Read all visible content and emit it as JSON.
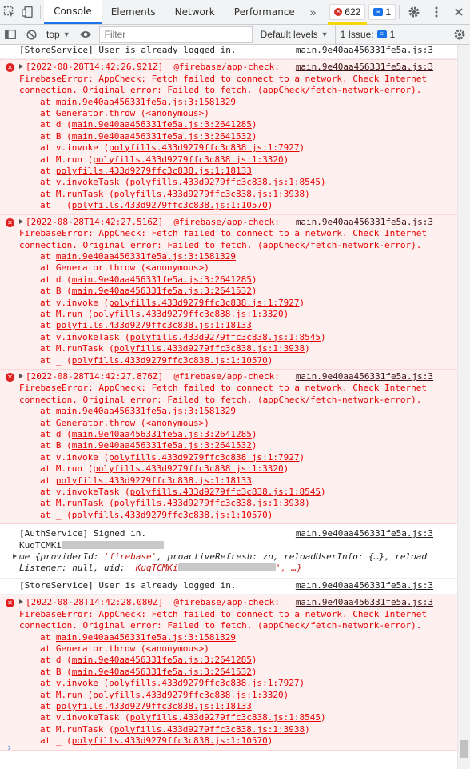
{
  "tabs": {
    "console": "Console",
    "elements": "Elements",
    "network": "Network",
    "performance": "Performance",
    "more": "»"
  },
  "badges": {
    "errors": "622",
    "messages": "1"
  },
  "toolbar": {
    "context": "top",
    "filter_placeholder": "Filter",
    "levels": "Default levels",
    "issues_label": "1 Issue:",
    "issues_count": "1"
  },
  "messages": {
    "store1": {
      "text": "[StoreService] User is already logged in.",
      "src": "main.9e40aa456331fe5a.js:3"
    },
    "err1": {
      "head": "[2022-08-28T14:42:26.921Z]  @firebase/app-check:",
      "src": "main.9e40aa456331fe5a.js:3",
      "line1": "FirebaseError: AppCheck: Fetch failed to connect to a network. Check Internet",
      "line2": "connection. Original error: Failed to fetch. (appCheck/fetch-network-error)."
    },
    "err2": {
      "head": "[2022-08-28T14:42:27.516Z]  @firebase/app-check:",
      "src": "main.9e40aa456331fe5a.js:3",
      "line1": "FirebaseError: AppCheck: Fetch failed to connect to a network. Check Internet",
      "line2": "connection. Original error: Failed to fetch. (appCheck/fetch-network-error)."
    },
    "err3": {
      "head": "[2022-08-28T14:42:27.876Z]  @firebase/app-check:",
      "src": "main.9e40aa456331fe5a.js:3",
      "line1": "FirebaseError: AppCheck: Fetch failed to connect to a network. Check Internet",
      "line2": "connection. Original error: Failed to fetch. (appCheck/fetch-network-error)."
    },
    "auth": {
      "line1": "[AuthService] Signed in.",
      "src": "main.9e40aa456331fe5a.js:3",
      "uid_prefix": "KuqTCMKi",
      "obj_line1_a": "me {providerId: ",
      "obj_line1_b": "'firebase'",
      "obj_line1_c": ", proactiveRefresh: zn, reloadUserInfo: {…}, reload",
      "obj_line2_a": "Listener: null, uid: ",
      "obj_line2_b": "'KuqTCMKi",
      "obj_line2_c": "', …}"
    },
    "store2": {
      "text": "[StoreService] User is already logged in.",
      "src": "main.9e40aa456331fe5a.js:3"
    },
    "err4": {
      "head": "[2022-08-28T14:42:28.080Z]  @firebase/app-check:",
      "src": "main.9e40aa456331fe5a.js:3",
      "line1": "FirebaseError: AppCheck: Fetch failed to connect to a network. Check Internet",
      "line2": "connection. Original error: Failed to fetch. (appCheck/fetch-network-error)."
    }
  },
  "stack": [
    {
      "fn": "at ",
      "loc": "main.9e40aa456331fe5a.js:3:1581329",
      "wrap": false
    },
    {
      "fn": "at Generator.throw (<anonymous>)",
      "loc": "",
      "wrap": false
    },
    {
      "fn": "at d (",
      "loc": "main.9e40aa456331fe5a.js:3:2641285",
      "wrap": true
    },
    {
      "fn": "at B (",
      "loc": "main.9e40aa456331fe5a.js:3:2641532",
      "wrap": true
    },
    {
      "fn": "at v.invoke (",
      "loc": "polyfills.433d9279ffc3c838.js:1:7927",
      "wrap": true
    },
    {
      "fn": "at M.run (",
      "loc": "polyfills.433d9279ffc3c838.js:1:3320",
      "wrap": true
    },
    {
      "fn": "at ",
      "loc": "polyfills.433d9279ffc3c838.js:1:18133",
      "wrap": false
    },
    {
      "fn": "at v.invokeTask (",
      "loc": "polyfills.433d9279ffc3c838.js:1:8545",
      "wrap": true
    },
    {
      "fn": "at M.runTask (",
      "loc": "polyfills.433d9279ffc3c838.js:1:3938",
      "wrap": true
    },
    {
      "fn": "at _ (",
      "loc": "polyfills.433d9279ffc3c838.js:1:10570",
      "wrap": true
    }
  ],
  "prompt": "›"
}
